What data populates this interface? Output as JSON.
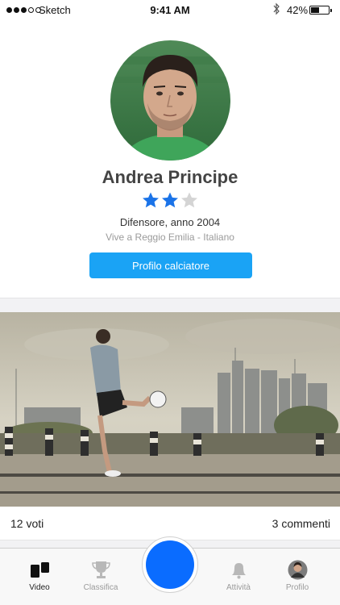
{
  "status": {
    "carrier": "Sketch",
    "time": "9:41 AM",
    "battery": "42%",
    "battery_level": 0.42,
    "signal_bars": 3,
    "signal_total": 5
  },
  "profile": {
    "name": "Andrea Principe",
    "rating": 2,
    "rating_max": 3,
    "role": "Difensore, anno 2004",
    "location": "Vive a Reggio Emilia - Italiano",
    "button_label": "Profilo calciatore"
  },
  "post": {
    "votes": "12 voti",
    "comments": "3 commenti"
  },
  "tabs": [
    {
      "label": "Video",
      "icon": "video-grid-icon",
      "active": true
    },
    {
      "label": "Classifica",
      "icon": "trophy-icon",
      "active": false
    },
    {
      "label": "Attività",
      "icon": "bell-icon",
      "active": false
    },
    {
      "label": "Profilo",
      "icon": "avatar-icon",
      "active": false
    }
  ],
  "colors": {
    "accent": "#1aa3f5",
    "record": "#0a6cff",
    "star_on": "#1a73e8",
    "star_off": "#d4d4d4"
  }
}
